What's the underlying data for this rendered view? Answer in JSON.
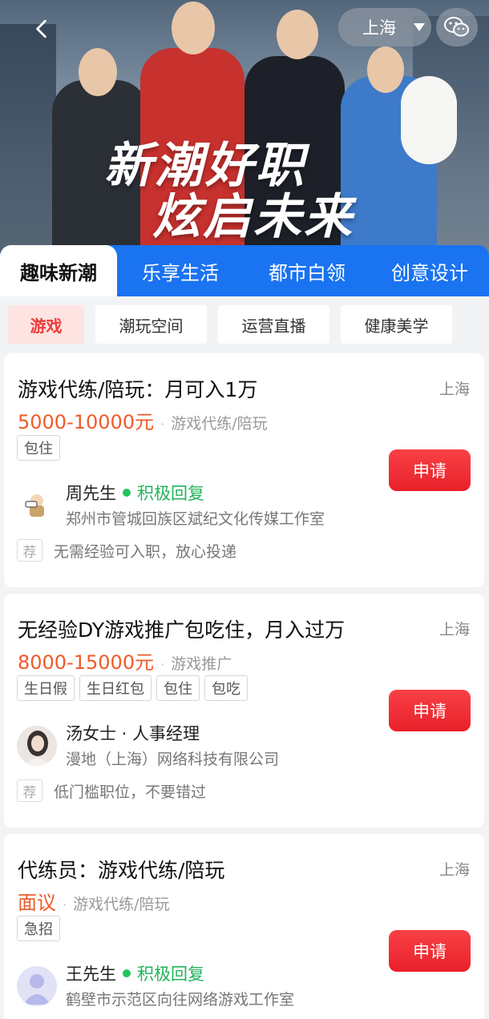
{
  "header": {
    "banner_line1": "新潮好职",
    "banner_line2": "炫启未来",
    "city": "上海"
  },
  "category_tabs": [
    {
      "label": "趣味新潮",
      "active": true
    },
    {
      "label": "乐享生活",
      "active": false
    },
    {
      "label": "都市白领",
      "active": false
    },
    {
      "label": "创意设计",
      "active": false
    }
  ],
  "sub_tabs": [
    {
      "label": "游戏",
      "active": true
    },
    {
      "label": "潮玩空间",
      "active": false
    },
    {
      "label": "运营直播",
      "active": false
    },
    {
      "label": "健康美学",
      "active": false
    }
  ],
  "jobs": [
    {
      "title": "游戏代练/陪玩：月可入1万",
      "city": "上海",
      "salary": "5000-10000元",
      "category": "游戏代练/陪玩",
      "tags": [
        "包住"
      ],
      "apply_label": "申请",
      "recruiter": "周先生",
      "recruiter_status": "积极回复",
      "company": "郑州市管城回族区斌纪文化传媒工作室",
      "rec_badge": "荐",
      "rec_text": "无需经验可入职，放心投递"
    },
    {
      "title": "无经验DY游戏推广包吃住，月入过万",
      "city": "上海",
      "salary": "8000-15000元",
      "category": "游戏推广",
      "tags": [
        "生日假",
        "生日红包",
        "包住",
        "包吃"
      ],
      "apply_label": "申请",
      "recruiter": "汤女士 · 人事经理",
      "company": "漫地（上海）网络科技有限公司",
      "rec_badge": "荐",
      "rec_text": "低门槛职位，不要错过"
    },
    {
      "title": "代练员：游戏代练/陪玩",
      "city": "上海",
      "salary": "面议",
      "category": "游戏代练/陪玩",
      "tags": [
        "急招"
      ],
      "apply_label": "申请",
      "recruiter": "王先生",
      "recruiter_status": "积极回复",
      "company": "鹤壁市示范区向往网络游戏工作室"
    }
  ],
  "colors": {
    "brand_blue": "#1a73f0",
    "apply_red": "#ef2b33",
    "salary_orange": "#f05a2a",
    "online_green": "#22b35a"
  }
}
